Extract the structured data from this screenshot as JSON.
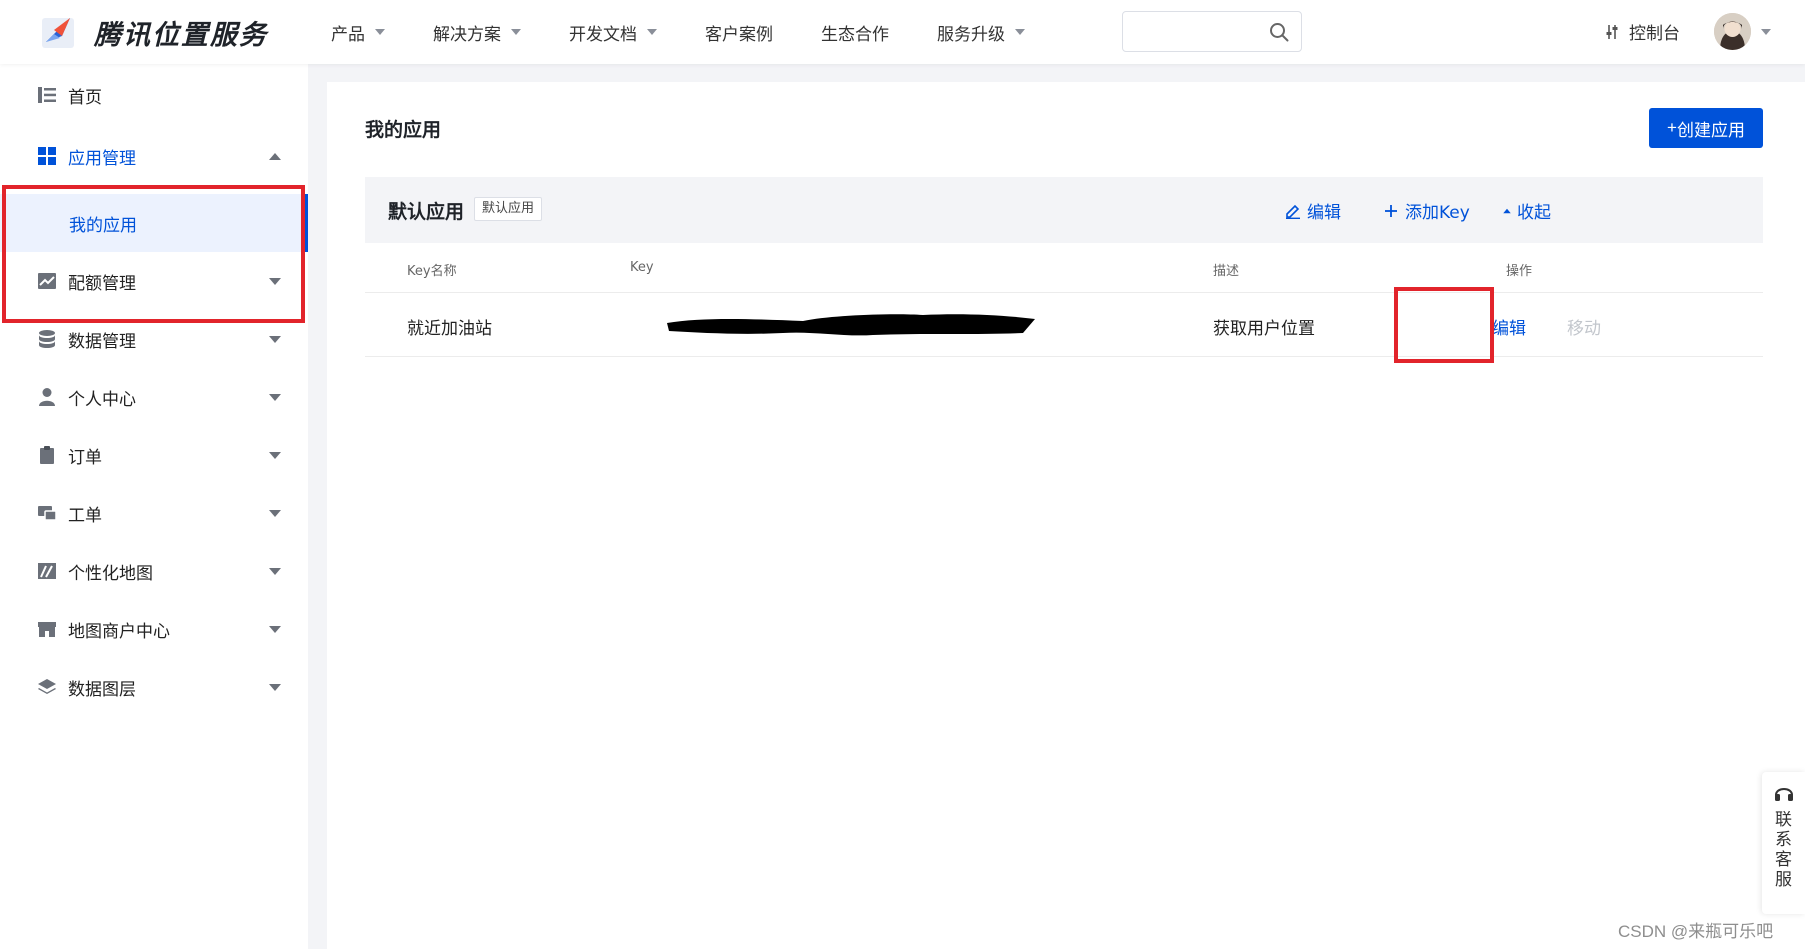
{
  "header": {
    "brand": "腾讯位置服务",
    "nav": [
      {
        "label": "产品",
        "has_caret": true
      },
      {
        "label": "解决方案",
        "has_caret": true
      },
      {
        "label": "开发文档",
        "has_caret": true
      },
      {
        "label": "客户案例",
        "has_caret": false
      },
      {
        "label": "生态合作",
        "has_caret": false
      },
      {
        "label": "服务升级",
        "has_caret": true
      }
    ],
    "search": {
      "value": "",
      "placeholder": ""
    },
    "console_label": "控制台"
  },
  "sidebar": {
    "items": [
      {
        "label": "首页",
        "icon": "home-list-icon"
      },
      {
        "label": "应用管理",
        "icon": "grid-icon",
        "expanded": true,
        "active": true
      },
      {
        "label": "配额管理",
        "icon": "chart-icon"
      },
      {
        "label": "数据管理",
        "icon": "database-icon"
      },
      {
        "label": "个人中心",
        "icon": "user-icon"
      },
      {
        "label": "订单",
        "icon": "clipboard-icon"
      },
      {
        "label": "工单",
        "icon": "ticket-icon"
      },
      {
        "label": "个性化地图",
        "icon": "custom-map-icon"
      },
      {
        "label": "地图商户中心",
        "icon": "store-icon"
      },
      {
        "label": "数据图层",
        "icon": "layers-icon"
      }
    ],
    "sub_item": {
      "label": "我的应用"
    }
  },
  "main": {
    "title": "我的应用",
    "create_button": "创建应用",
    "create_button_plus": "+",
    "app": {
      "name": "默认应用",
      "tag": "默认应用",
      "actions": {
        "edit": "编辑",
        "add_key": "添加Key",
        "collapse": "收起"
      }
    },
    "table": {
      "columns": [
        "Key名称",
        "Key",
        "描述",
        "操作"
      ],
      "rows": [
        {
          "name": "就近加油站",
          "key": "",
          "description": "获取用户位置",
          "op_edit": "编辑",
          "op_move": "移动"
        }
      ]
    }
  },
  "contact": {
    "label": "联系客服"
  },
  "watermark": "CSDN @来瓶可乐吧",
  "colors": {
    "accent": "#0052d9",
    "highlight_box": "#e2242b",
    "menu_active_bg": "#ecf2fe"
  }
}
